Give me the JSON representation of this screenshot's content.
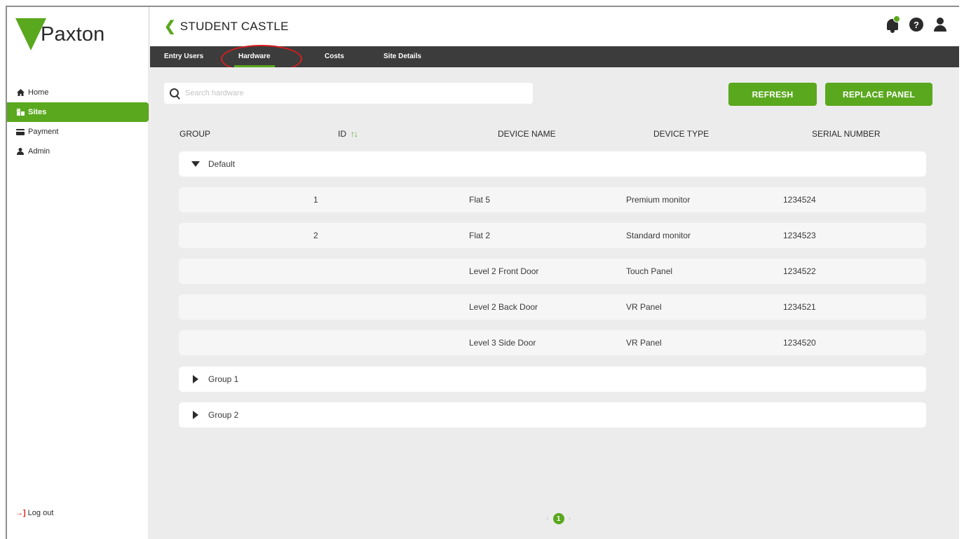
{
  "brand": {
    "logo_text": "Paxton",
    "accent_color": "#5aa81e"
  },
  "sidebar": {
    "items": [
      {
        "label": "Home",
        "icon": "home-icon"
      },
      {
        "label": "Sites",
        "icon": "sites-icon",
        "active": true
      },
      {
        "label": "Payment",
        "icon": "payment-icon"
      },
      {
        "label": "Admin",
        "icon": "admin-icon"
      }
    ],
    "logout_label": "Log out"
  },
  "header": {
    "back_title": "STUDENT CASTLE",
    "icons": [
      "notification-bell-icon",
      "help-icon",
      "user-icon"
    ]
  },
  "tabs": [
    {
      "label": "Entry Users"
    },
    {
      "label": "Hardware",
      "active": true
    },
    {
      "label": "Costs"
    },
    {
      "label": "Site Details"
    }
  ],
  "toolbar": {
    "search_placeholder": "Search hardware",
    "refresh_label": "REFRESH",
    "replace_label": "REPLACE PANEL"
  },
  "table": {
    "columns": [
      "GROUP",
      "ID",
      "DEVICE NAME",
      "DEVICE TYPE",
      "SERIAL NUMBER"
    ],
    "sort_glyph": "↑↓",
    "groups": [
      {
        "name": "Default",
        "expanded": true,
        "rows": [
          {
            "id": "1",
            "device_name": "Flat 5",
            "device_type": "Premium monitor",
            "serial": "1234524"
          },
          {
            "id": "2",
            "device_name": "Flat 2",
            "device_type": "Standard monitor",
            "serial": "1234523"
          },
          {
            "id": "",
            "device_name": "Level 2 Front Door",
            "device_type": "Touch Panel",
            "serial": "1234522"
          },
          {
            "id": "",
            "device_name": "Level 2 Back Door",
            "device_type": "VR Panel",
            "serial": "1234521"
          },
          {
            "id": "",
            "device_name": "Level 3 Side Door",
            "device_type": "VR Panel",
            "serial": "1234520"
          }
        ]
      },
      {
        "name": "Group 1",
        "expanded": false,
        "rows": []
      },
      {
        "name": "Group 2",
        "expanded": false,
        "rows": []
      }
    ]
  },
  "pagination": {
    "current": "1",
    "prev": "‹",
    "next": "›"
  }
}
